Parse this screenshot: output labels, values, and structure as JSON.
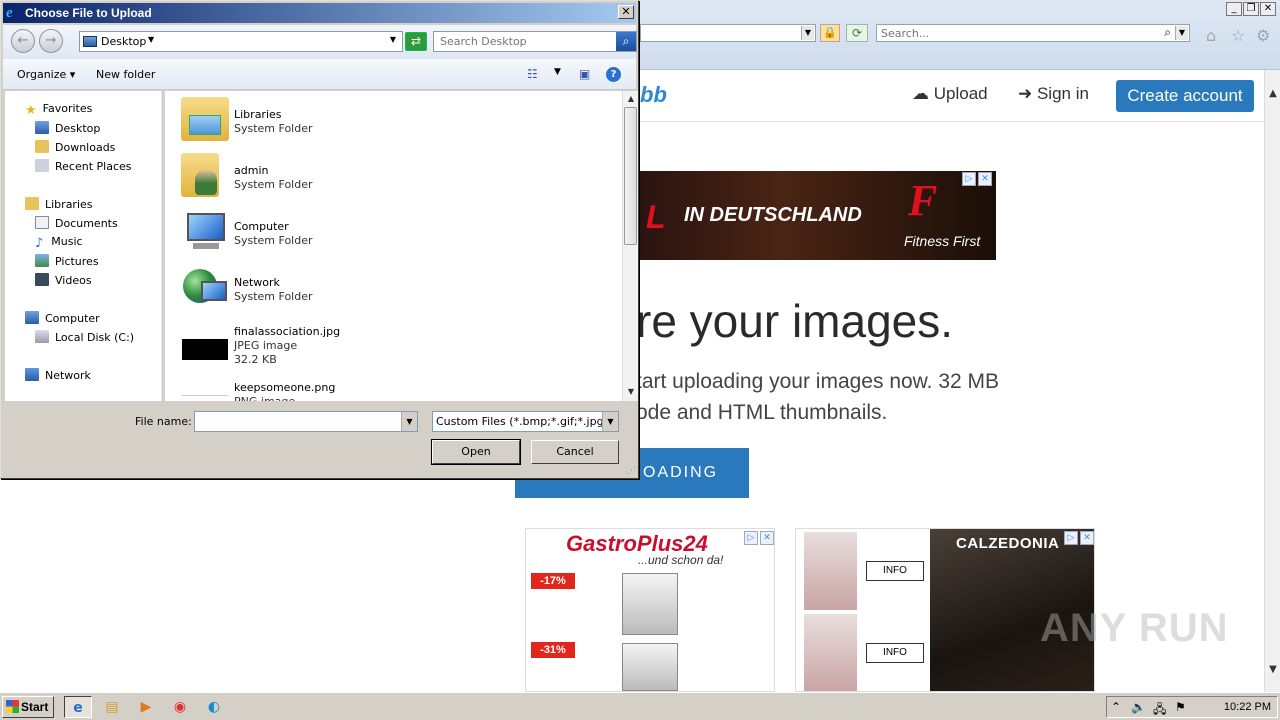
{
  "dialog": {
    "title": "Choose File to Upload",
    "close_glyph": "✕",
    "location": "Desktop",
    "search_placeholder": "Search Desktop",
    "toolbar": {
      "organize_label": "Organize",
      "new_folder_label": "New folder",
      "help_glyph": "?"
    },
    "nav_pane": {
      "favorites": {
        "label": "Favorites",
        "items": [
          "Desktop",
          "Downloads",
          "Recent Places"
        ]
      },
      "libraries": {
        "label": "Libraries",
        "items": [
          "Documents",
          "Music",
          "Pictures",
          "Videos"
        ]
      },
      "computer": {
        "label": "Computer",
        "items": [
          "Local Disk (C:)"
        ]
      },
      "network": {
        "label": "Network"
      }
    },
    "files": [
      {
        "name": "Libraries",
        "type": "System Folder",
        "size": "",
        "icon": "libraries-folder-icon"
      },
      {
        "name": "admin",
        "type": "System Folder",
        "size": "",
        "icon": "user-folder-icon"
      },
      {
        "name": "Computer",
        "type": "System Folder",
        "size": "",
        "icon": "computer-icon"
      },
      {
        "name": "Network",
        "type": "System Folder",
        "size": "",
        "icon": "network-icon"
      },
      {
        "name": "finalassociation.jpg",
        "type": "JPEG image",
        "size": "32.2 KB",
        "icon": "jpeg-thumbnail"
      },
      {
        "name": "keepsomeone.png",
        "type": "PNG image",
        "size": "",
        "icon": "png-thumbnail"
      }
    ],
    "file_name_label": "File name:",
    "file_name_value": "",
    "filter_value": "Custom Files (*.bmp;*.gif;*.jpg;",
    "open_label": "Open",
    "cancel_label": "Cancel"
  },
  "browser": {
    "search_placeholder": "Search...",
    "window_controls": [
      "_",
      "❐",
      "✕"
    ]
  },
  "site": {
    "logo_fragment": "bb",
    "upload_label": "Upload",
    "signin_label": "Sign in",
    "create_account_label": "Create account",
    "banner_ad": {
      "headline": "IN DEUTSCHLAND",
      "brand": "Fitness First",
      "lead_glyph": "L",
      "logo_glyph": "F"
    },
    "hero_title": "re your images.",
    "hero_line1": "tart uploading your images now. 32 MB",
    "hero_line2": "ode and HTML thumbnails.",
    "start_button_label": "OADING",
    "gastro_ad": {
      "brand": "GastroPlus24",
      "tagline": "...und schon da!",
      "discounts": [
        "-17%",
        "-31%"
      ]
    },
    "calzedonia_ad": {
      "brand": "CALZEDONIA",
      "info_labels": [
        "INFO",
        "INFO"
      ]
    }
  },
  "watermark": "ANY RUN",
  "taskbar": {
    "start_label": "Start",
    "clock": "10:22 PM"
  },
  "colors": {
    "titlebar_start": "#0a246a",
    "titlebar_end": "#a6caf0",
    "site_accent": "#2a79bd"
  }
}
